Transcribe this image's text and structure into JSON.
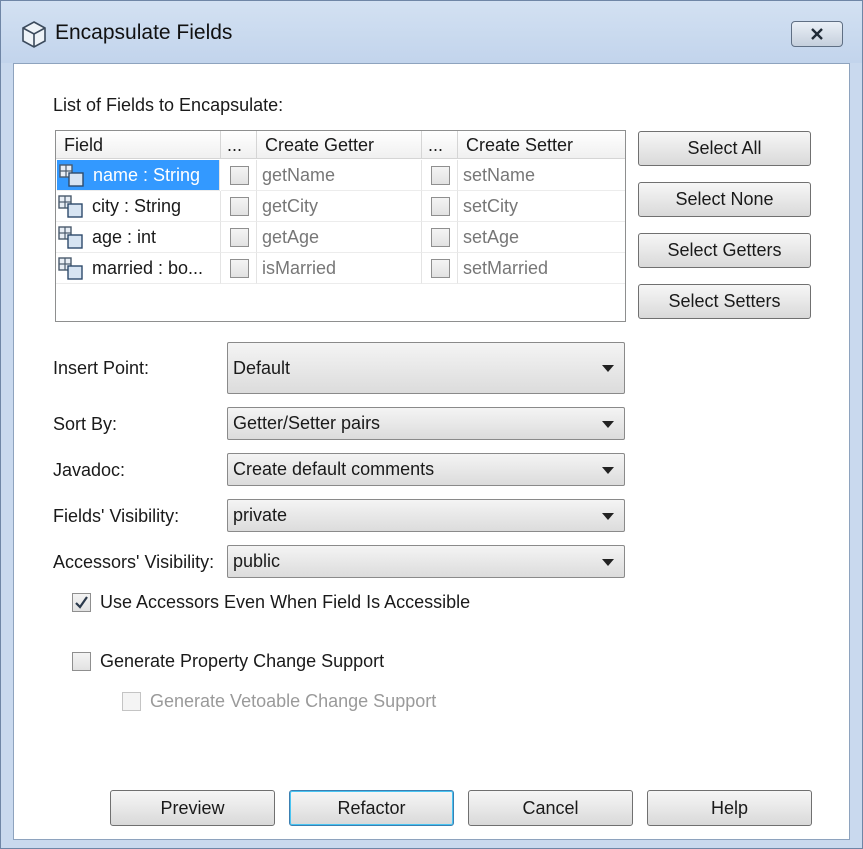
{
  "window": {
    "title": "Encapsulate Fields",
    "close_label": "X"
  },
  "fields_list": {
    "label": "List of Fields to Encapsulate:",
    "columns": [
      "Field",
      "...",
      "Create Getter",
      "...",
      "Create Setter"
    ],
    "rows": [
      {
        "field": "name : String",
        "getter": "getName",
        "setter": "setName",
        "getter_checked": false,
        "setter_checked": false,
        "selected": true
      },
      {
        "field": "city : String",
        "getter": "getCity",
        "setter": "setCity",
        "getter_checked": false,
        "setter_checked": false,
        "selected": false
      },
      {
        "field": "age : int",
        "getter": "getAge",
        "setter": "setAge",
        "getter_checked": false,
        "setter_checked": false,
        "selected": false
      },
      {
        "field": "married : bo...",
        "getter": "isMarried",
        "setter": "setMarried",
        "getter_checked": false,
        "setter_checked": false,
        "selected": false
      }
    ]
  },
  "side_buttons": {
    "select_all": "Select All",
    "select_none": "Select None",
    "select_getters": "Select Getters",
    "select_setters": "Select Setters"
  },
  "options": {
    "insert_point": {
      "label": "Insert Point:",
      "value": "Default"
    },
    "sort_by": {
      "label": "Sort By:",
      "value": "Getter/Setter pairs"
    },
    "javadoc": {
      "label": "Javadoc:",
      "value": "Create default comments"
    },
    "fields_visibility": {
      "label": "Fields' Visibility:",
      "value": "private"
    },
    "accessors_visibility": {
      "label": "Accessors' Visibility:",
      "value": "public"
    }
  },
  "checkboxes": {
    "use_accessors": {
      "label": "Use Accessors Even When Field Is Accessible",
      "checked": true
    },
    "property_change": {
      "label": "Generate Property Change Support",
      "checked": false
    },
    "vetoable_change": {
      "label": "Generate Vetoable Change Support",
      "checked": false,
      "enabled": false
    }
  },
  "buttons": {
    "preview": "Preview",
    "refactor": "Refactor",
    "cancel": "Cancel",
    "help": "Help"
  },
  "colors": {
    "selection": "#3399ff",
    "window_frame": "#c9d9ee"
  }
}
